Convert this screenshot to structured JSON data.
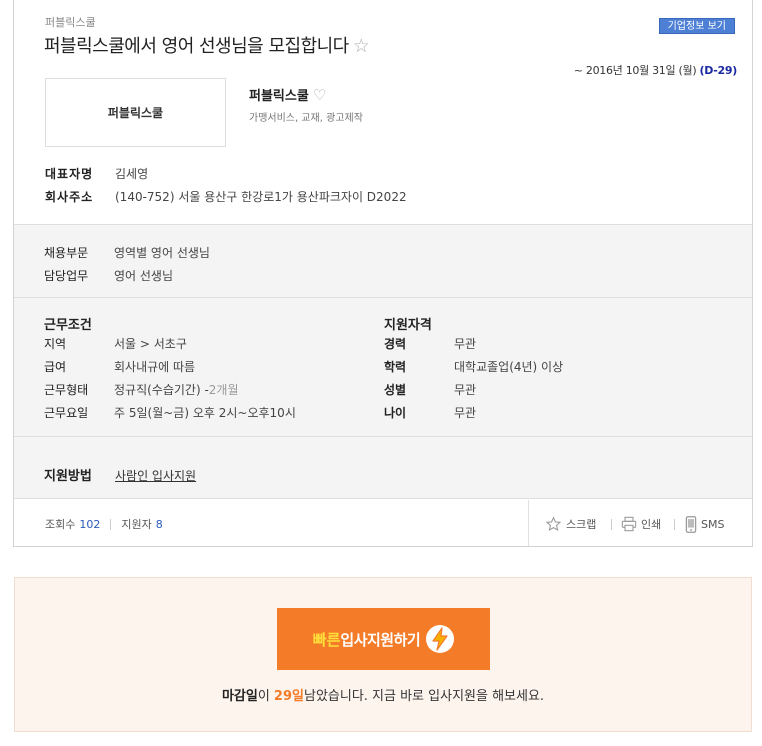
{
  "header": {
    "company_small": "퍼블릭스쿨",
    "title": "퍼블릭스쿨에서 영어 선생님을 모집합니다",
    "corp_info_button": "기업정보 보기",
    "deadline": "~ 2016년 10월 31일 (월)",
    "dday": "(D-29)"
  },
  "company": {
    "logo_text": "퍼블릭스쿨",
    "name": "퍼블릭스쿨",
    "category": "가맹서비스, 교재, 광고제작",
    "ceo_label": "대표자명",
    "ceo": "김세영",
    "address_label": "회사주소",
    "address": "(140-752) 서울 용산구 한강로1가 용산파크자이 D2022"
  },
  "recruit": {
    "field_label": "채용부문",
    "field": "영역별 영어 선생님",
    "duty_label": "담당업무",
    "duty": "영어 선생님"
  },
  "conditions": {
    "title": "근무조건",
    "rows": [
      {
        "label": "지역",
        "value": "서울 > 서초구"
      },
      {
        "label": "급여",
        "value": "회사내규에 따름"
      },
      {
        "label": "근무형태",
        "value": "정규직(수습기간) -",
        "sub": "2개월"
      },
      {
        "label": "근무요일",
        "value": "주 5일(월~금) 오후 2시~오후10시"
      }
    ]
  },
  "qualifications": {
    "title": "지원자격",
    "rows": [
      {
        "label": "경력",
        "value": "무관"
      },
      {
        "label": "학력",
        "value": "대학교졸업(4년) 이상"
      },
      {
        "label": "성별",
        "value": "무관"
      },
      {
        "label": "나이",
        "value": "무관"
      }
    ]
  },
  "apply_method": {
    "label": "지원방법",
    "link": "사람인 입사지원"
  },
  "stats": {
    "views_label": "조회수",
    "views": "102",
    "applicants_label": "지원자",
    "applicants": "8"
  },
  "tools": {
    "scrap": "스크랩",
    "print": "인쇄",
    "sms": "SMS"
  },
  "apply_panel": {
    "quick": "빠른",
    "main": "입사지원하기",
    "msg_prefix": "마감일",
    "msg_mid": "이 ",
    "days": "29일",
    "msg_suffix": "남았습니다. 지금 바로 입사지원을 해보세요."
  },
  "colors": {
    "accent": "#f47c28",
    "link_blue": "#2a5ab8",
    "corp_btn": "#4d7fd5"
  }
}
